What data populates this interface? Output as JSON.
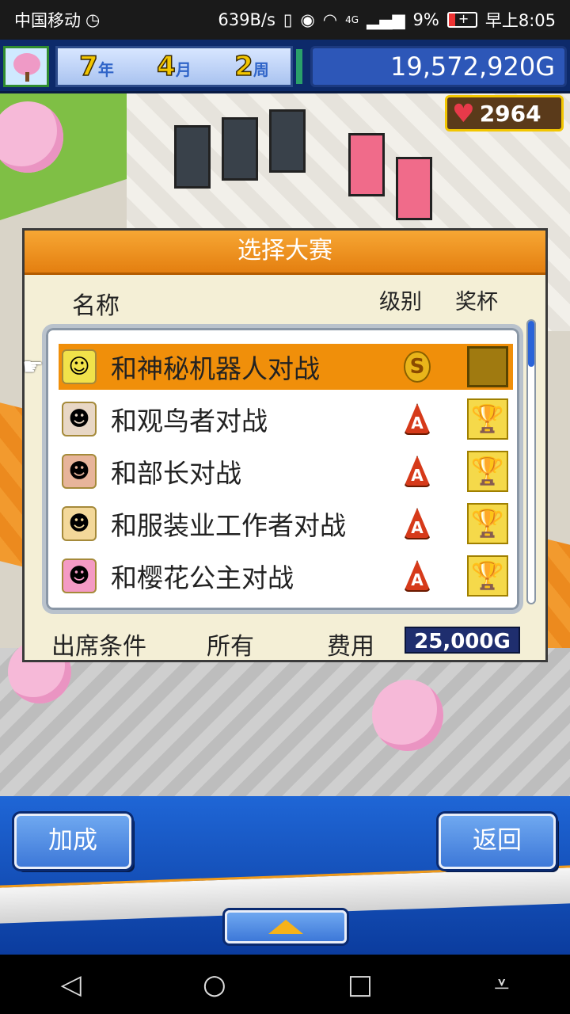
{
  "status_bar": {
    "carrier": "中国移动",
    "carrier_icon": "clock-icon",
    "network_speed": "639B/s",
    "signal_label": "4G",
    "battery_percent": "9%",
    "time": "早上8:05"
  },
  "hud": {
    "year_value": "7",
    "year_unit": "年",
    "month_value": "4",
    "month_unit": "月",
    "week_value": "2",
    "week_unit": "周",
    "money": "19,572,920G",
    "hearts": "2964"
  },
  "dialog": {
    "title": "选择大赛",
    "col_name": "名称",
    "col_level": "级别",
    "col_trophy": "奖杯",
    "rows": [
      {
        "name": "和神秘机器人对战",
        "level": "S",
        "avatar_icon": "robot-avatar-icon",
        "trophy": "locked"
      },
      {
        "name": "和观鸟者对战",
        "level": "A",
        "avatar_icon": "birdwatcher-avatar-icon",
        "trophy": "gold"
      },
      {
        "name": "和部长对战",
        "level": "A",
        "avatar_icon": "director-avatar-icon",
        "trophy": "gold"
      },
      {
        "name": "和服装业工作者对战",
        "level": "A",
        "avatar_icon": "fashion-worker-avatar-icon",
        "trophy": "gold"
      },
      {
        "name": "和樱花公主对战",
        "level": "A",
        "avatar_icon": "sakura-princess-avatar-icon",
        "trophy": "gold"
      }
    ],
    "footer": {
      "condition_label": "出席条件",
      "condition_value": "所有",
      "cost_label": "费用",
      "cost_value": "25,000G"
    }
  },
  "buttons": {
    "boost": "加成",
    "back": "返回"
  },
  "colors": {
    "accent_orange": "#f08f0a",
    "panel_blue": "#1f66d6",
    "selected_row": "#f08f0a"
  }
}
